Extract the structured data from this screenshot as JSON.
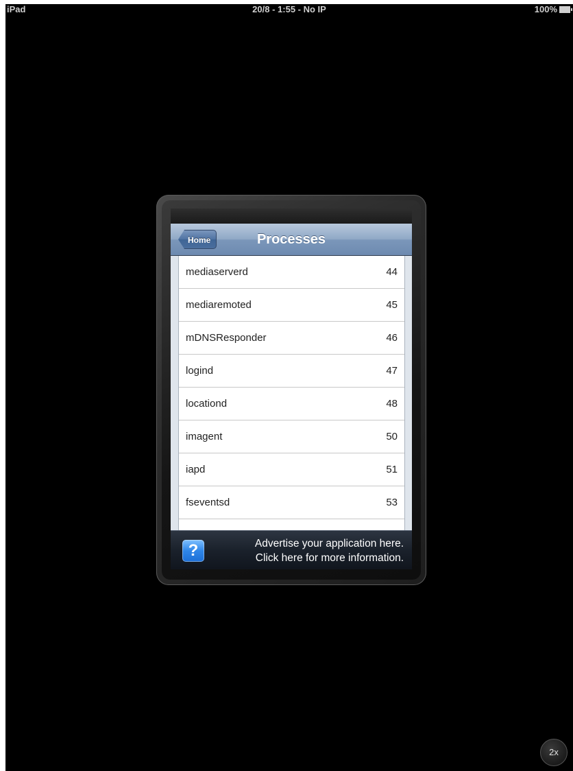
{
  "status_bar": {
    "device": "iPad",
    "center": "20/8 - 1:55 - No IP",
    "battery": "100%",
    "battery_icon": "battery-full-icon"
  },
  "navbar": {
    "back_label": "Home",
    "title": "Processes"
  },
  "processes": [
    {
      "name": "mediaserverd",
      "pid": "44"
    },
    {
      "name": "mediaremoted",
      "pid": "45"
    },
    {
      "name": "mDNSResponder",
      "pid": "46"
    },
    {
      "name": "logind",
      "pid": "47"
    },
    {
      "name": "locationd",
      "pid": "48"
    },
    {
      "name": "imagent",
      "pid": "50"
    },
    {
      "name": "iapd",
      "pid": "51"
    },
    {
      "name": "fseventsd",
      "pid": "53"
    }
  ],
  "ad_banner": {
    "icon": "question-mark-icon",
    "icon_glyph": "?",
    "line1": "Advertise your application here.",
    "line2": "Click here for more information."
  },
  "zoom_button": {
    "label": "2x"
  },
  "colors": {
    "background": "#000000",
    "navbar": "#8fa8c6",
    "back_button": "#4f73a3",
    "list_background": "#ffffff",
    "ad_icon": "#2f86e8"
  }
}
